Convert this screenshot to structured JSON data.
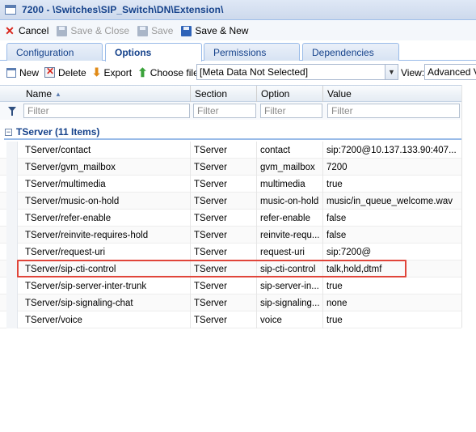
{
  "window": {
    "title": "7200 - \\Switches\\SIP_Switch\\DN\\Extension\\"
  },
  "toolbar": {
    "cancel": "Cancel",
    "save_close": "Save & Close",
    "save": "Save",
    "save_new": "Save & New"
  },
  "tabs": [
    {
      "label": "Configuration",
      "active": false
    },
    {
      "label": "Options",
      "active": true
    },
    {
      "label": "Permissions",
      "active": false
    },
    {
      "label": "Dependencies",
      "active": false
    }
  ],
  "subtoolbar": {
    "new": "New",
    "delete": "Delete",
    "export": "Export",
    "choose_file": "Choose file",
    "metadata_value": "[Meta Data Not Selected]",
    "view_label": "View:",
    "view_value": "Advanced V"
  },
  "grid": {
    "columns": {
      "name": "Name",
      "section": "Section",
      "option": "Option",
      "value": "Value"
    },
    "sort": {
      "column": "name",
      "direction": "ascending"
    },
    "filter_placeholder": "Filter",
    "group_label": "TServer (11 Items)",
    "rows": [
      {
        "name": "TServer/contact",
        "section": "TServer",
        "option": "contact",
        "value": "sip:7200@10.137.133.90:407..."
      },
      {
        "name": "TServer/gvm_mailbox",
        "section": "TServer",
        "option": "gvm_mailbox",
        "value": "7200"
      },
      {
        "name": "TServer/multimedia",
        "section": "TServer",
        "option": "multimedia",
        "value": "true"
      },
      {
        "name": "TServer/music-on-hold",
        "section": "TServer",
        "option": "music-on-hold",
        "value": "music/in_queue_welcome.wav"
      },
      {
        "name": "TServer/refer-enable",
        "section": "TServer",
        "option": "refer-enable",
        "value": "false"
      },
      {
        "name": "TServer/reinvite-requires-hold",
        "section": "TServer",
        "option": "reinvite-requ...",
        "value": "false"
      },
      {
        "name": "TServer/request-uri",
        "section": "TServer",
        "option": "request-uri",
        "value": "sip:7200@"
      },
      {
        "name": "TServer/sip-cti-control",
        "section": "TServer",
        "option": "sip-cti-control",
        "value": "talk,hold,dtmf"
      },
      {
        "name": "TServer/sip-server-inter-trunk",
        "section": "TServer",
        "option": "sip-server-in...",
        "value": "true"
      },
      {
        "name": "TServer/sip-signaling-chat",
        "section": "TServer",
        "option": "sip-signaling...",
        "value": "none"
      },
      {
        "name": "TServer/voice",
        "section": "TServer",
        "option": "voice",
        "value": "true"
      }
    ],
    "highlighted_row": "TServer/sip-cti-control"
  },
  "colors": {
    "accent": "#15428b",
    "highlight_border": "#e0453a",
    "header_border": "#99bbe8"
  },
  "icons": [
    "window-icon",
    "cancel-icon",
    "save-icon",
    "new-icon",
    "delete-icon",
    "export-icon",
    "choose-file-icon",
    "dropdown-arrow-icon",
    "filter-icon",
    "sort-asc-icon",
    "group-collapse-icon"
  ]
}
